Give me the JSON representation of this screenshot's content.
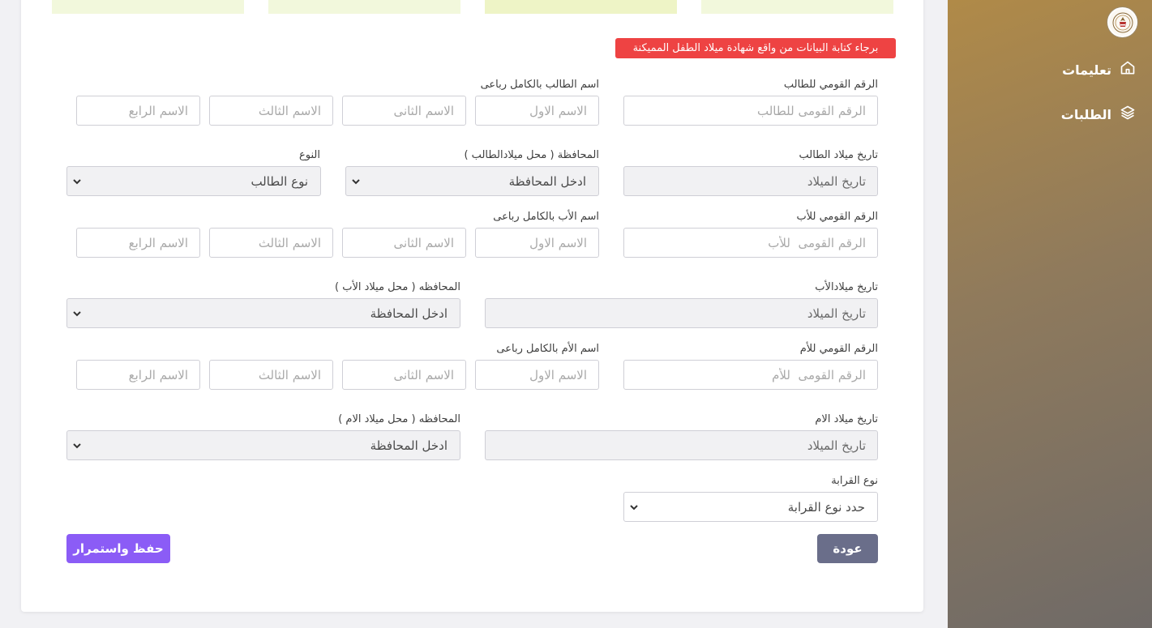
{
  "sidebar": {
    "items": [
      {
        "label": "تعليمات",
        "icon": "home-icon"
      },
      {
        "label": "الطلبات",
        "icon": "layers-icon"
      }
    ]
  },
  "notice": "برجاء كتابة البيانات من واقع شهادة ميلاد الطفل المميكنة",
  "student": {
    "national_id_label": "الرقم القومي للطالب",
    "national_id_placeholder": "الرقم القومى للطالب",
    "fullname_label": "اسم الطالب بالكامل رباعى",
    "birthdate_label": "تاريخ ميلاد الطالب",
    "birthdate_placeholder": "تاريخ الميلاد",
    "governorate_label": "المحافظة ( محل ميلادالطالب )",
    "governorate_value": "ادخل المحافظة",
    "gender_label": "النوع",
    "gender_value": "نوع الطالب"
  },
  "father": {
    "national_id_label": "الرقم القومي للأب",
    "national_id_placeholder": "الرقم القومى  للأب",
    "fullname_label": "اسم الأب بالكامل رباعى",
    "birthdate_label": "تاريخ ميلادالأب",
    "birthdate_placeholder": "تاريخ الميلاد",
    "governorate_label": "المحافظه ( محل ميلاد الأب )",
    "governorate_value": "ادخل المحافظة"
  },
  "mother": {
    "national_id_label": "الرقم القومي للأم",
    "national_id_placeholder": "الرقم القومى  للأم",
    "fullname_label": "اسم الأم بالكامل رباعى",
    "birthdate_label": "تاريخ ميلاد الام",
    "birthdate_placeholder": "تاريخ الميلاد",
    "governorate_label": "المحافظه ( محل ميلاد الام )",
    "governorate_value": "ادخل المحافظة"
  },
  "name_parts": {
    "first": "الاسم الاول",
    "second": "الاسم الثانى",
    "third": "الاسم الثالث",
    "fourth": "الاسم الرابع"
  },
  "relation": {
    "label": "نوع القرابة",
    "value": "حدد نوع القرابة"
  },
  "buttons": {
    "back": "عودة",
    "save": "حفظ واستمرار"
  },
  "colors": {
    "notice": "#ee4343",
    "save_button": "#8b5cf6",
    "back_button": "#6a6e8a",
    "step_tab": "#f2f8dc"
  }
}
